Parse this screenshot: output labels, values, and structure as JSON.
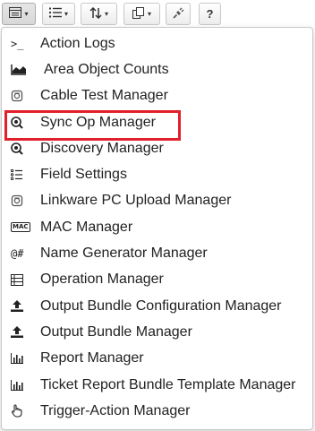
{
  "toolbar": {
    "buttons": [
      {
        "icon": "window-list-icon",
        "caret": "▾"
      },
      {
        "icon": "bulleted-list-icon",
        "caret": "▾"
      },
      {
        "icon": "sort-icon",
        "caret": "▾"
      },
      {
        "icon": "copy-icon",
        "caret": "▾"
      },
      {
        "icon": "plug-icon"
      },
      {
        "icon": "help-icon",
        "label": "?"
      }
    ]
  },
  "menu": {
    "items": [
      {
        "label": "Action Logs",
        "icon": "terminal-icon",
        "icon_text": ">_"
      },
      {
        "label": "Area Object Counts",
        "icon": "area-chart-icon"
      },
      {
        "label": "Cable Test Manager",
        "icon": "cable-tester-icon"
      },
      {
        "label": "Sync Op Manager",
        "icon": "search-sync-icon",
        "highlighted": true
      },
      {
        "label": "Discovery Manager",
        "icon": "discovery-icon"
      },
      {
        "label": "Field Settings",
        "icon": "field-list-icon"
      },
      {
        "label": "Linkware PC Upload Manager",
        "icon": "linkware-icon"
      },
      {
        "label": "MAC Manager",
        "icon": "mac-icon",
        "icon_text": "MAC"
      },
      {
        "label": "Name Generator Manager",
        "icon": "name-generator-icon",
        "icon_text": "@#"
      },
      {
        "label": "Operation Manager",
        "icon": "operation-list-icon"
      },
      {
        "label": "Output Bundle Configuration Manager",
        "icon": "upload-icon"
      },
      {
        "label": "Output Bundle Manager",
        "icon": "upload-icon"
      },
      {
        "label": "Report Manager",
        "icon": "bar-chart-icon"
      },
      {
        "label": "Ticket Report Bundle Template Manager",
        "icon": "bar-chart-icon"
      },
      {
        "label": "Trigger-Action Manager",
        "icon": "pointer-hand-icon"
      }
    ],
    "highlight_color": "#e0202a"
  }
}
